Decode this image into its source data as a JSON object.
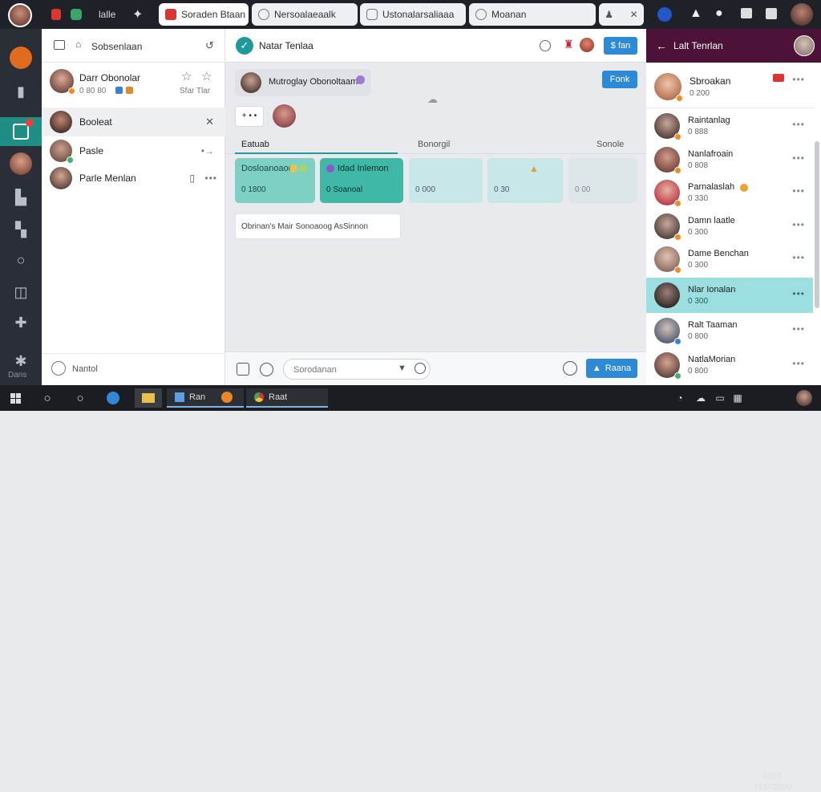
{
  "titlebar": {
    "app_label": "lalle",
    "tabs": [
      {
        "label": "Soraden Btaan",
        "icon": "red-square-icon",
        "active": true
      },
      {
        "label": "Nersoalaeaalk",
        "icon": "clock-icon",
        "active": false
      },
      {
        "label": "Ustonalarsaliaaa",
        "icon": "lock-icon",
        "active": false
      },
      {
        "label": "Moanan",
        "icon": "gear-icon",
        "active": false
      }
    ]
  },
  "chatlist": {
    "header_title": "Sobsenlaan",
    "pinned": {
      "name": "Darr Obonolar",
      "meta": "0 80 80",
      "meta2": "Sfar Tlar"
    },
    "items": [
      {
        "name": "Booleat"
      },
      {
        "name": "Pasle"
      },
      {
        "name": "Parle Menlan"
      }
    ],
    "footer_label": "Nantol"
  },
  "center": {
    "header_title": "Natar Tenlaa",
    "header_button": "$ fan",
    "message_text": "Mutroglay Obonoltaam",
    "action_button": "Fonk",
    "reply_chip": "+ • •",
    "tabs": [
      "Eatuab",
      "Bonorgil",
      "Sonole"
    ],
    "cards": [
      {
        "title": "Dosloanoaoo",
        "value": "0 1800"
      },
      {
        "title": "Idad Inlemon",
        "value": "0 Soanoal"
      },
      {
        "title": "",
        "value": "0 000"
      },
      {
        "title": "",
        "value": "0 30"
      },
      {
        "title": "",
        "value": "0 00"
      }
    ],
    "notice": "Obrinan's Mair Sonoaoog AsSinnon",
    "composer_placeholder": "Sorodanan",
    "send_button": "Raana"
  },
  "rightpanel": {
    "header_title": "Lalt Tenrlan",
    "items": [
      {
        "name": "Sbroakan",
        "sub": "0 200"
      },
      {
        "name": "Raintanlag",
        "sub": "0 888"
      },
      {
        "name": "Nanlafroain",
        "sub": "0 808"
      },
      {
        "name": "Parnalaslah",
        "sub": "0 330"
      },
      {
        "name": "Damn laatle",
        "sub": "0 300"
      },
      {
        "name": "Dame Benchan",
        "sub": "0 300"
      },
      {
        "name": "Nlar Ionalan",
        "sub": "0 300"
      },
      {
        "name": "Ralt Taaman",
        "sub": "0 800"
      },
      {
        "name": "NatlaMorian",
        "sub": "0 800"
      }
    ]
  },
  "taskbar": {
    "app1": "Ran",
    "app2": "Raat",
    "time": "1560",
    "date": "7137/2000"
  },
  "rail": {
    "bottom_label": "Dans"
  }
}
